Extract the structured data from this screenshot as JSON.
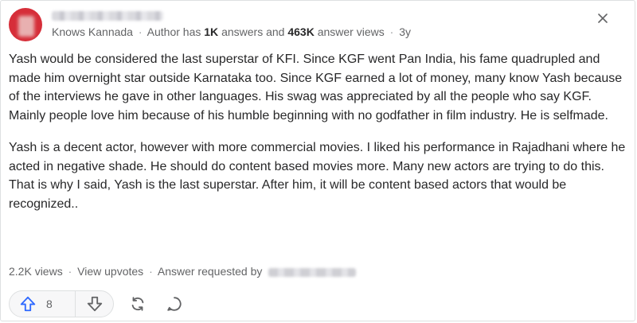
{
  "author": {
    "credential": "Knows Kannada",
    "stats_prefix": "Author has",
    "answers_count": "1K",
    "answers_label": "answers and",
    "views_count": "463K",
    "views_label": "answer views",
    "age": "3y"
  },
  "answer": {
    "paragraphs": [
      "Yash would be considered the last superstar of KFI. Since KGF went Pan India, his fame quadrupled and made him overnight star outside Karnataka too. Since KGF earned a lot of money, many know Yash because of the interviews he gave in other languages. His swag was appreciated by all the people who say KGF. Mainly people love him because of his humble beginning with no godfather in film industry. He is selfmade.",
      "Yash is a decent actor, however with more commercial movies. I liked his performance in Rajadhani where he acted in negative shade. He should do content based movies more. Many new actors are trying to do this. That is why I said, Yash is the last superstar. After him, it will be content based actors that would be recognized.."
    ]
  },
  "meta": {
    "views": "2.2K views",
    "view_upvotes": "View upvotes",
    "requested": "Answer requested by"
  },
  "actions": {
    "upvote_count": "8"
  },
  "colors": {
    "avatar": "#d62e39",
    "upvote_icon": "#2e69ff",
    "text": "#282829",
    "muted": "#636466"
  },
  "icons": [
    "close-icon",
    "upvote-arrow-icon",
    "downvote-arrow-icon",
    "share-icon",
    "comment-icon"
  ]
}
